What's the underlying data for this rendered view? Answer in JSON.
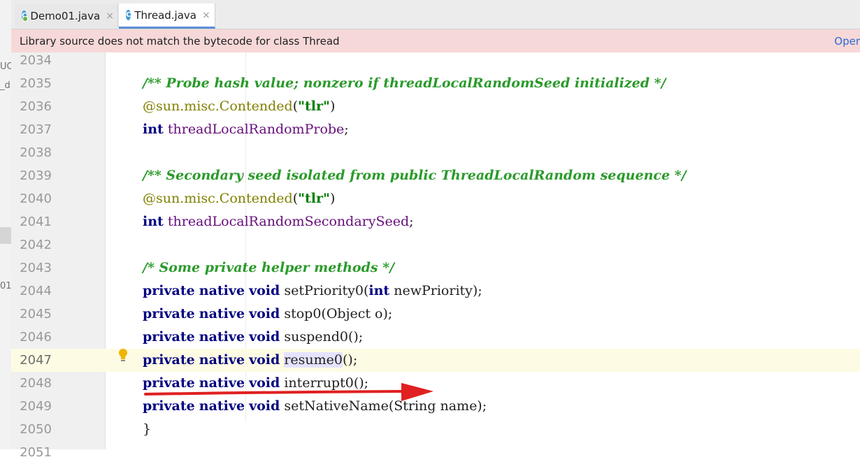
{
  "tabs": [
    {
      "label": "Demo01.java",
      "active": false,
      "icon": "java-class-icon"
    },
    {
      "label": "Thread.java",
      "active": true,
      "icon": "library-class-icon"
    }
  ],
  "tab_close_glyph": "×",
  "banner": {
    "message": "Library source does not match the bytecode for class Thread",
    "action": "Oper"
  },
  "left_panel_fragments": [
    "UC",
    "_d",
    "01"
  ],
  "editor": {
    "current_line": "2047",
    "lines": [
      {
        "num": "2034",
        "code": ""
      },
      {
        "num": "2035",
        "code": "/** Probe hash value; nonzero if threadLocalRandomSeed initialized */"
      },
      {
        "num": "2036",
        "code": "@sun.misc.Contended(\"tlr\")"
      },
      {
        "num": "2037",
        "code": "int threadLocalRandomProbe;"
      },
      {
        "num": "2038",
        "code": ""
      },
      {
        "num": "2039",
        "code": "/** Secondary seed isolated from public ThreadLocalRandom sequence */"
      },
      {
        "num": "2040",
        "code": "@sun.misc.Contended(\"tlr\")"
      },
      {
        "num": "2041",
        "code": "int threadLocalRandomSecondarySeed;"
      },
      {
        "num": "2042",
        "code": ""
      },
      {
        "num": "2043",
        "code": "/* Some private helper methods */"
      },
      {
        "num": "2044",
        "code": "private native void setPriority0(int newPriority);"
      },
      {
        "num": "2045",
        "code": "private native void stop0(Object o);"
      },
      {
        "num": "2046",
        "code": "private native void suspend0();"
      },
      {
        "num": "2047",
        "code": "private native void resume0();"
      },
      {
        "num": "2048",
        "code": "private native void interrupt0();"
      },
      {
        "num": "2049",
        "code": "private native void setNativeName(String name);"
      },
      {
        "num": "2050",
        "code": "}"
      },
      {
        "num": "2051",
        "code": ""
      }
    ]
  },
  "colors": {
    "keyword": "#000080",
    "comment": "#2a9a2a",
    "annotation": "#808000",
    "string": "#008000",
    "field": "#660e7a",
    "banner_bg": "#f7d8d8",
    "arrow": "#e02020"
  },
  "intention_icon": "lightbulb-icon"
}
